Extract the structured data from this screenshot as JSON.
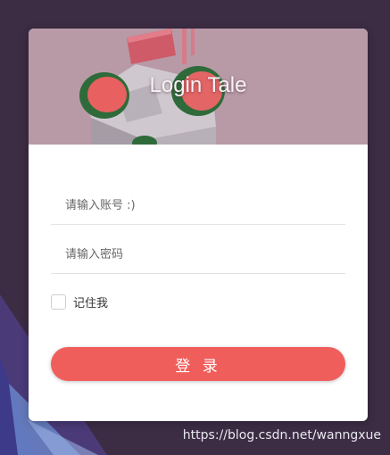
{
  "banner": {
    "title": "Login Tale"
  },
  "form": {
    "account_placeholder": "请输入账号 :)",
    "password_placeholder": "请输入密码",
    "remember_label": "记住我",
    "remember_checked": false,
    "login_label": "登 录"
  },
  "watermark": "https://blog.csdn.net/wanngxue",
  "colors": {
    "page_bg": "#3c2c44",
    "banner_bg": "#b89aa6",
    "accent": "#f05e5b",
    "card_bg": "#ffffff"
  }
}
